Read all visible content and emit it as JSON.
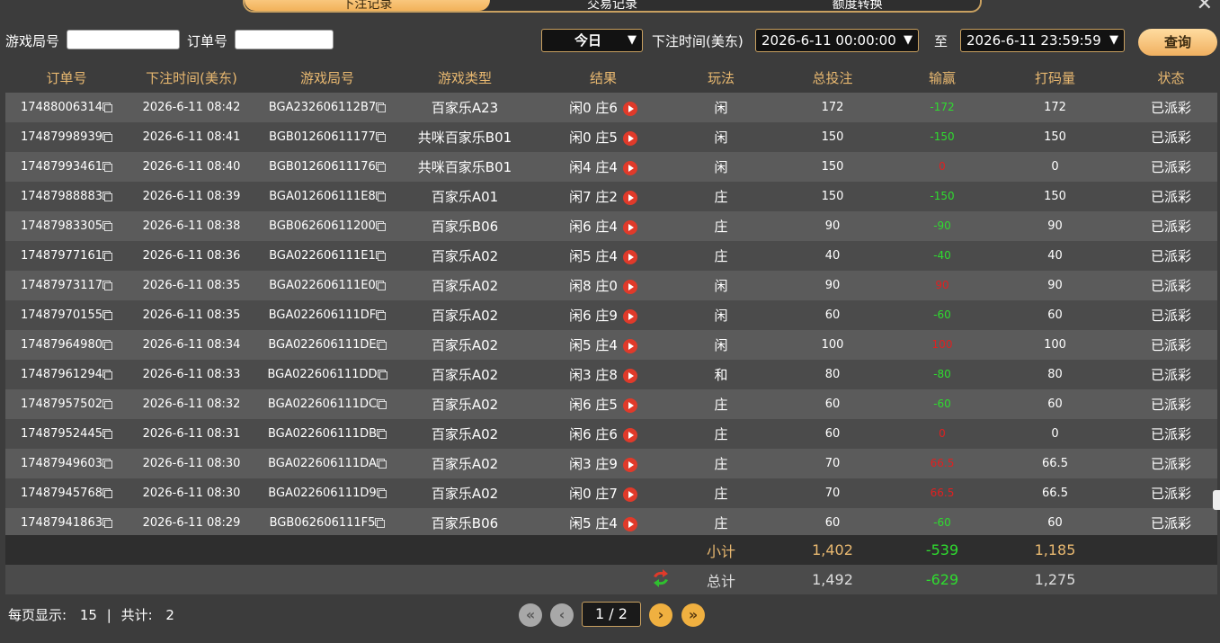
{
  "tabs": [
    {
      "label": "下注记录"
    },
    {
      "label": "交易记录"
    },
    {
      "label": "额度转换"
    }
  ],
  "filters": {
    "game_no_label": "游戏局号",
    "game_no_value": "",
    "order_no_label": "订单号",
    "order_no_value": "",
    "range_select": "今日",
    "time_label": "下注时间(美东)",
    "start_time": "2026-6-11 00:00:00",
    "to_label": "至",
    "end_time": "2026-6-11 23:59:59",
    "query_label": "查询"
  },
  "table": {
    "headers": [
      "订单号",
      "下注时间(美东)",
      "游戏局号",
      "游戏类型",
      "结果",
      "玩法",
      "总投注",
      "输赢",
      "打码量",
      "状态"
    ],
    "rows": [
      {
        "order": "17488006314",
        "time": "2026-6-11 08:42",
        "round": "BGA232606112B7",
        "game": "百家乐A23",
        "result": "闲0 庄6",
        "play": "闲",
        "bet": "172",
        "win": "-172",
        "wintype": "neg",
        "turnover": "172",
        "status": "已派彩"
      },
      {
        "order": "17487998939",
        "time": "2026-6-11 08:41",
        "round": "BGB01260611177",
        "game": "共咪百家乐B01",
        "result": "闲0 庄5",
        "play": "闲",
        "bet": "150",
        "win": "-150",
        "wintype": "neg",
        "turnover": "150",
        "status": "已派彩"
      },
      {
        "order": "17487993461",
        "time": "2026-6-11 08:40",
        "round": "BGB01260611176",
        "game": "共咪百家乐B01",
        "result": "闲4 庄4",
        "play": "闲",
        "bet": "150",
        "win": "0",
        "wintype": "zero",
        "turnover": "0",
        "status": "已派彩"
      },
      {
        "order": "17487988883",
        "time": "2026-6-11 08:39",
        "round": "BGA012606111E8",
        "game": "百家乐A01",
        "result": "闲7 庄2",
        "play": "庄",
        "bet": "150",
        "win": "-150",
        "wintype": "neg",
        "turnover": "150",
        "status": "已派彩"
      },
      {
        "order": "17487983305",
        "time": "2026-6-11 08:38",
        "round": "BGB06260611200",
        "game": "百家乐B06",
        "result": "闲6 庄4",
        "play": "庄",
        "bet": "90",
        "win": "-90",
        "wintype": "neg",
        "turnover": "90",
        "status": "已派彩"
      },
      {
        "order": "17487977161",
        "time": "2026-6-11 08:36",
        "round": "BGA022606111E1",
        "game": "百家乐A02",
        "result": "闲5 庄4",
        "play": "庄",
        "bet": "40",
        "win": "-40",
        "wintype": "neg",
        "turnover": "40",
        "status": "已派彩"
      },
      {
        "order": "17487973117",
        "time": "2026-6-11 08:35",
        "round": "BGA022606111E0",
        "game": "百家乐A02",
        "result": "闲8 庄0",
        "play": "闲",
        "bet": "90",
        "win": "90",
        "wintype": "pos",
        "turnover": "90",
        "status": "已派彩"
      },
      {
        "order": "17487970155",
        "time": "2026-6-11 08:35",
        "round": "BGA022606111DF",
        "game": "百家乐A02",
        "result": "闲6 庄9",
        "play": "闲",
        "bet": "60",
        "win": "-60",
        "wintype": "neg",
        "turnover": "60",
        "status": "已派彩"
      },
      {
        "order": "17487964980",
        "time": "2026-6-11 08:34",
        "round": "BGA022606111DE",
        "game": "百家乐A02",
        "result": "闲5 庄4",
        "play": "闲",
        "bet": "100",
        "win": "100",
        "wintype": "pos",
        "turnover": "100",
        "status": "已派彩"
      },
      {
        "order": "17487961294",
        "time": "2026-6-11 08:33",
        "round": "BGA022606111DD",
        "game": "百家乐A02",
        "result": "闲3 庄8",
        "play": "和",
        "bet": "80",
        "win": "-80",
        "wintype": "neg",
        "turnover": "80",
        "status": "已派彩"
      },
      {
        "order": "17487957502",
        "time": "2026-6-11 08:32",
        "round": "BGA022606111DC",
        "game": "百家乐A02",
        "result": "闲6 庄5",
        "play": "庄",
        "bet": "60",
        "win": "-60",
        "wintype": "neg",
        "turnover": "60",
        "status": "已派彩"
      },
      {
        "order": "17487952445",
        "time": "2026-6-11 08:31",
        "round": "BGA022606111DB",
        "game": "百家乐A02",
        "result": "闲6 庄6",
        "play": "庄",
        "bet": "60",
        "win": "0",
        "wintype": "zero",
        "turnover": "0",
        "status": "已派彩"
      },
      {
        "order": "17487949603",
        "time": "2026-6-11 08:30",
        "round": "BGA022606111DA",
        "game": "百家乐A02",
        "result": "闲3 庄9",
        "play": "庄",
        "bet": "70",
        "win": "66.5",
        "wintype": "pos",
        "turnover": "66.5",
        "status": "已派彩"
      },
      {
        "order": "17487945768",
        "time": "2026-6-11 08:30",
        "round": "BGA022606111D9",
        "game": "百家乐A02",
        "result": "闲0 庄7",
        "play": "庄",
        "bet": "70",
        "win": "66.5",
        "wintype": "pos",
        "turnover": "66.5",
        "status": "已派彩"
      },
      {
        "order": "17487941863",
        "time": "2026-6-11 08:29",
        "round": "BGB062606111F5",
        "game": "百家乐B06",
        "result": "闲5 庄4",
        "play": "庄",
        "bet": "60",
        "win": "-60",
        "wintype": "neg",
        "turnover": "60",
        "status": "已派彩"
      }
    ]
  },
  "subtotal": {
    "label": "小计",
    "bet": "1,402",
    "win": "-539",
    "turnover": "1,185"
  },
  "total": {
    "label": "总计",
    "bet": "1,492",
    "win": "-629",
    "turnover": "1,275"
  },
  "footer": {
    "per_page_label": "每页显示:",
    "per_page_value": "15",
    "separator": "|",
    "total_label": "共计:",
    "total_value": "2",
    "page_text": "1 / 2",
    "first_icon": "«",
    "prev_icon": "‹",
    "next_icon": "›",
    "last_icon": "»"
  },
  "colors": {
    "accent": "#e8b870",
    "win_negative": "#2fdc2f",
    "win_positive": "#e02020"
  }
}
